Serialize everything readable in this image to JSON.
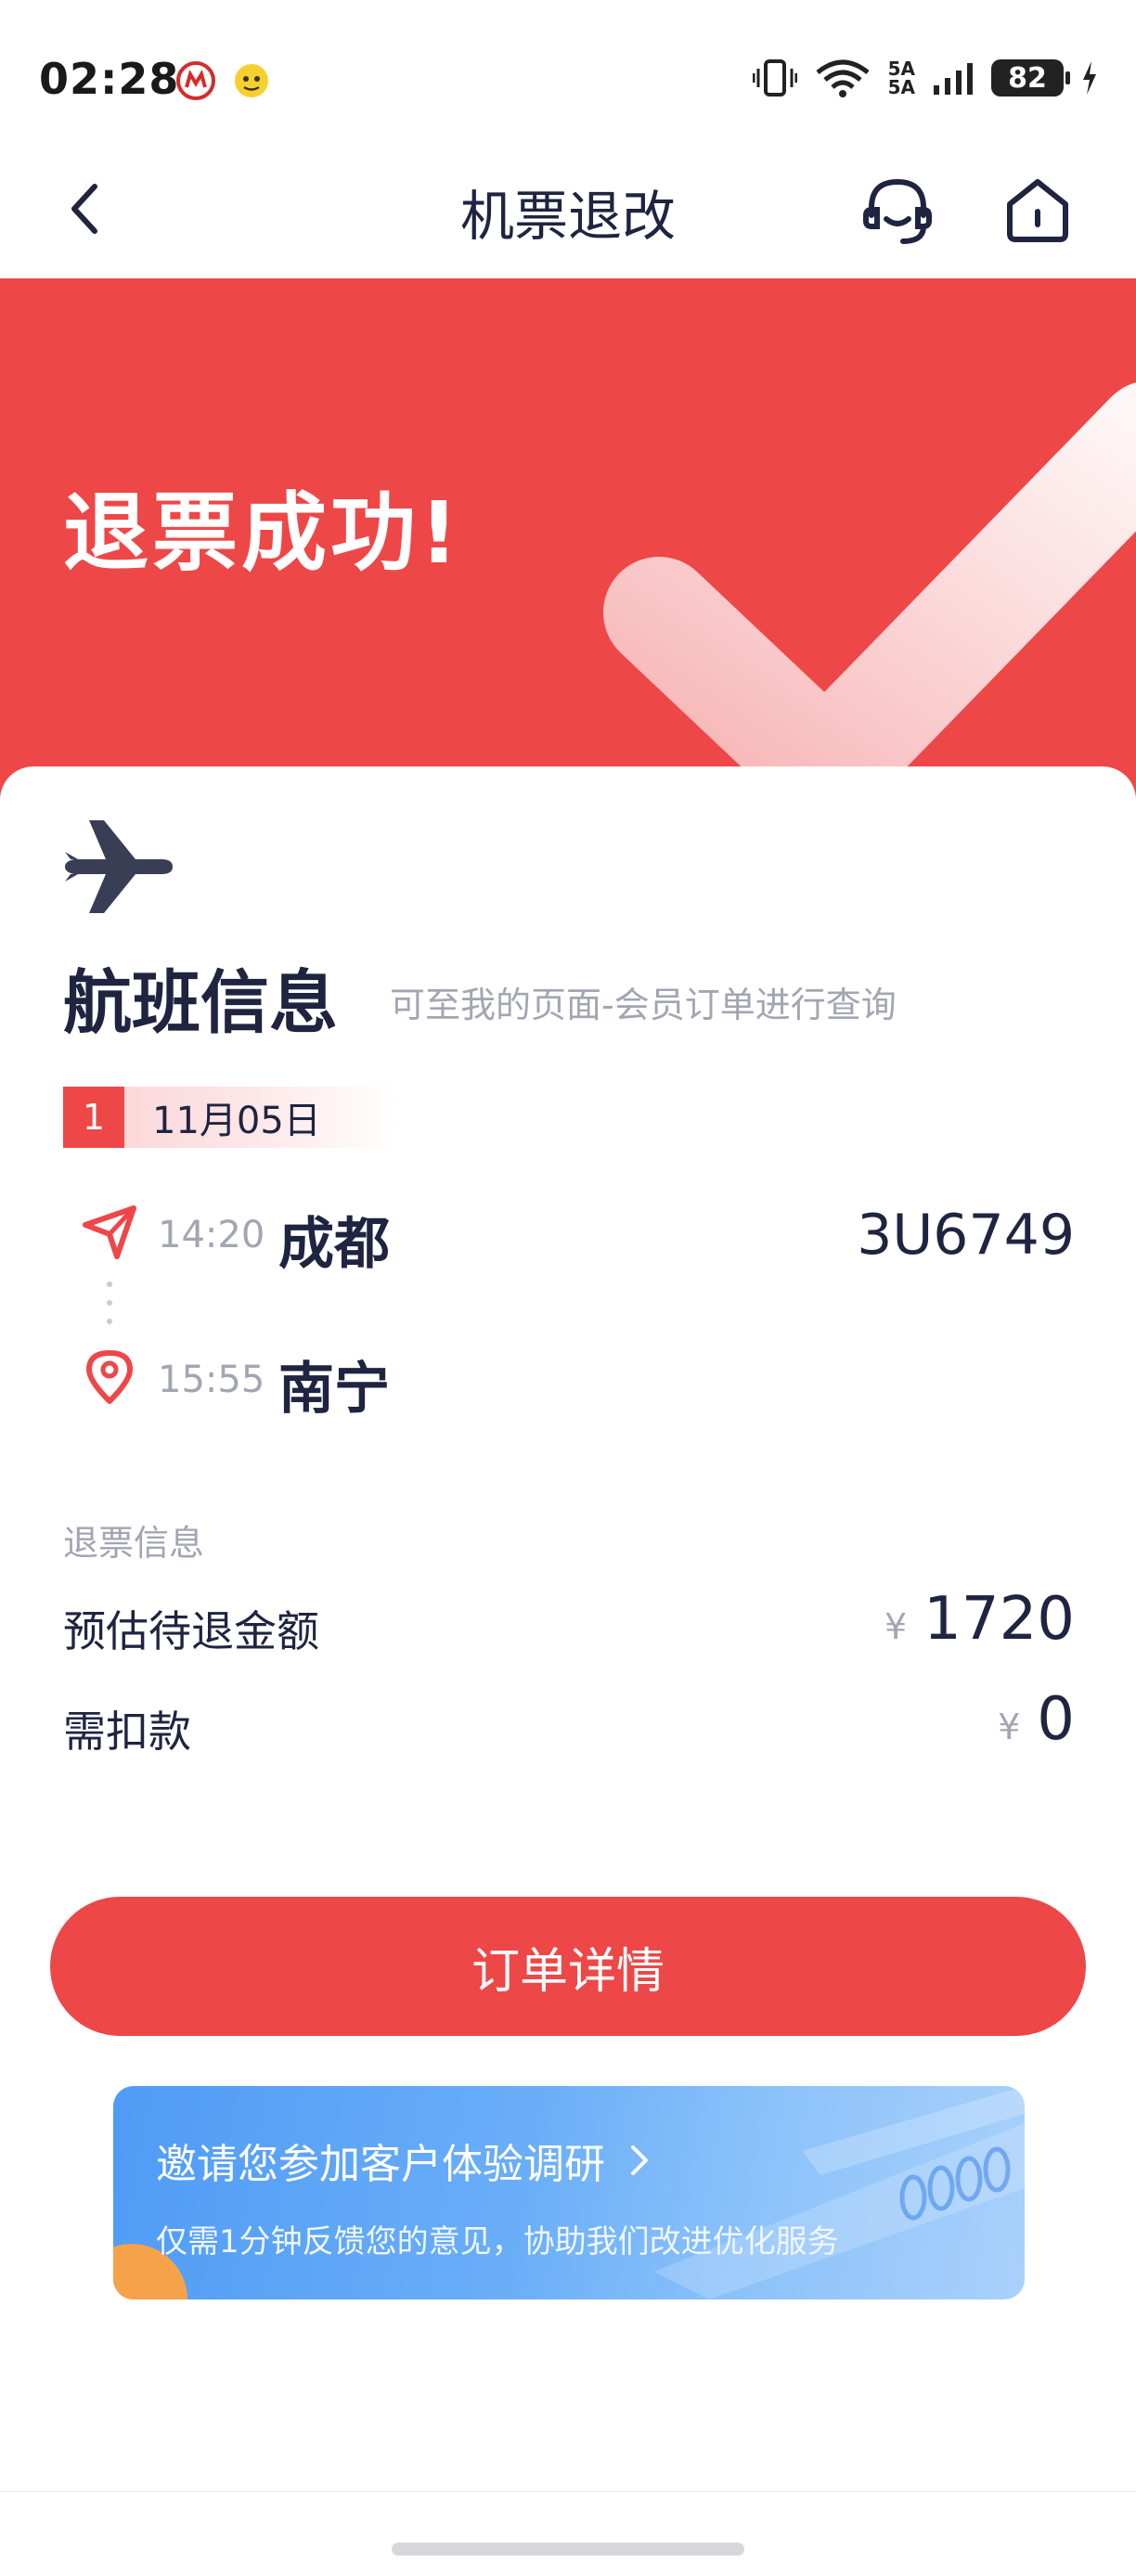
{
  "status_bar": {
    "time": "02:28",
    "network_top": "5A",
    "network_bottom": "5A",
    "battery": "82"
  },
  "nav": {
    "title": "机票退改"
  },
  "banner": {
    "title": "退票成功!",
    "color": "#ee4748"
  },
  "flight_info": {
    "title": "航班信息",
    "hint": "可至我的页面-会员订单进行查询",
    "segment_index": "1",
    "date": "11月05日",
    "flight_number": "3U6749",
    "departure": {
      "time": "14:20",
      "city": "成都",
      "icon": "send-icon"
    },
    "arrival": {
      "time": "15:55",
      "city": "南宁",
      "icon": "location-pin-icon"
    }
  },
  "refund_info": {
    "label": "退票信息",
    "estimated_label": "预估待退金额",
    "estimated_currency": "¥",
    "estimated_amount": "1720",
    "deduction_label": "需扣款",
    "deduction_currency": "¥",
    "deduction_amount": "0"
  },
  "actions": {
    "order_detail": "订单详情"
  },
  "survey": {
    "title": "邀请您参加客户体验调研",
    "subtitle": "仅需1分钟反馈您的意见，协助我们改进优化服务"
  }
}
